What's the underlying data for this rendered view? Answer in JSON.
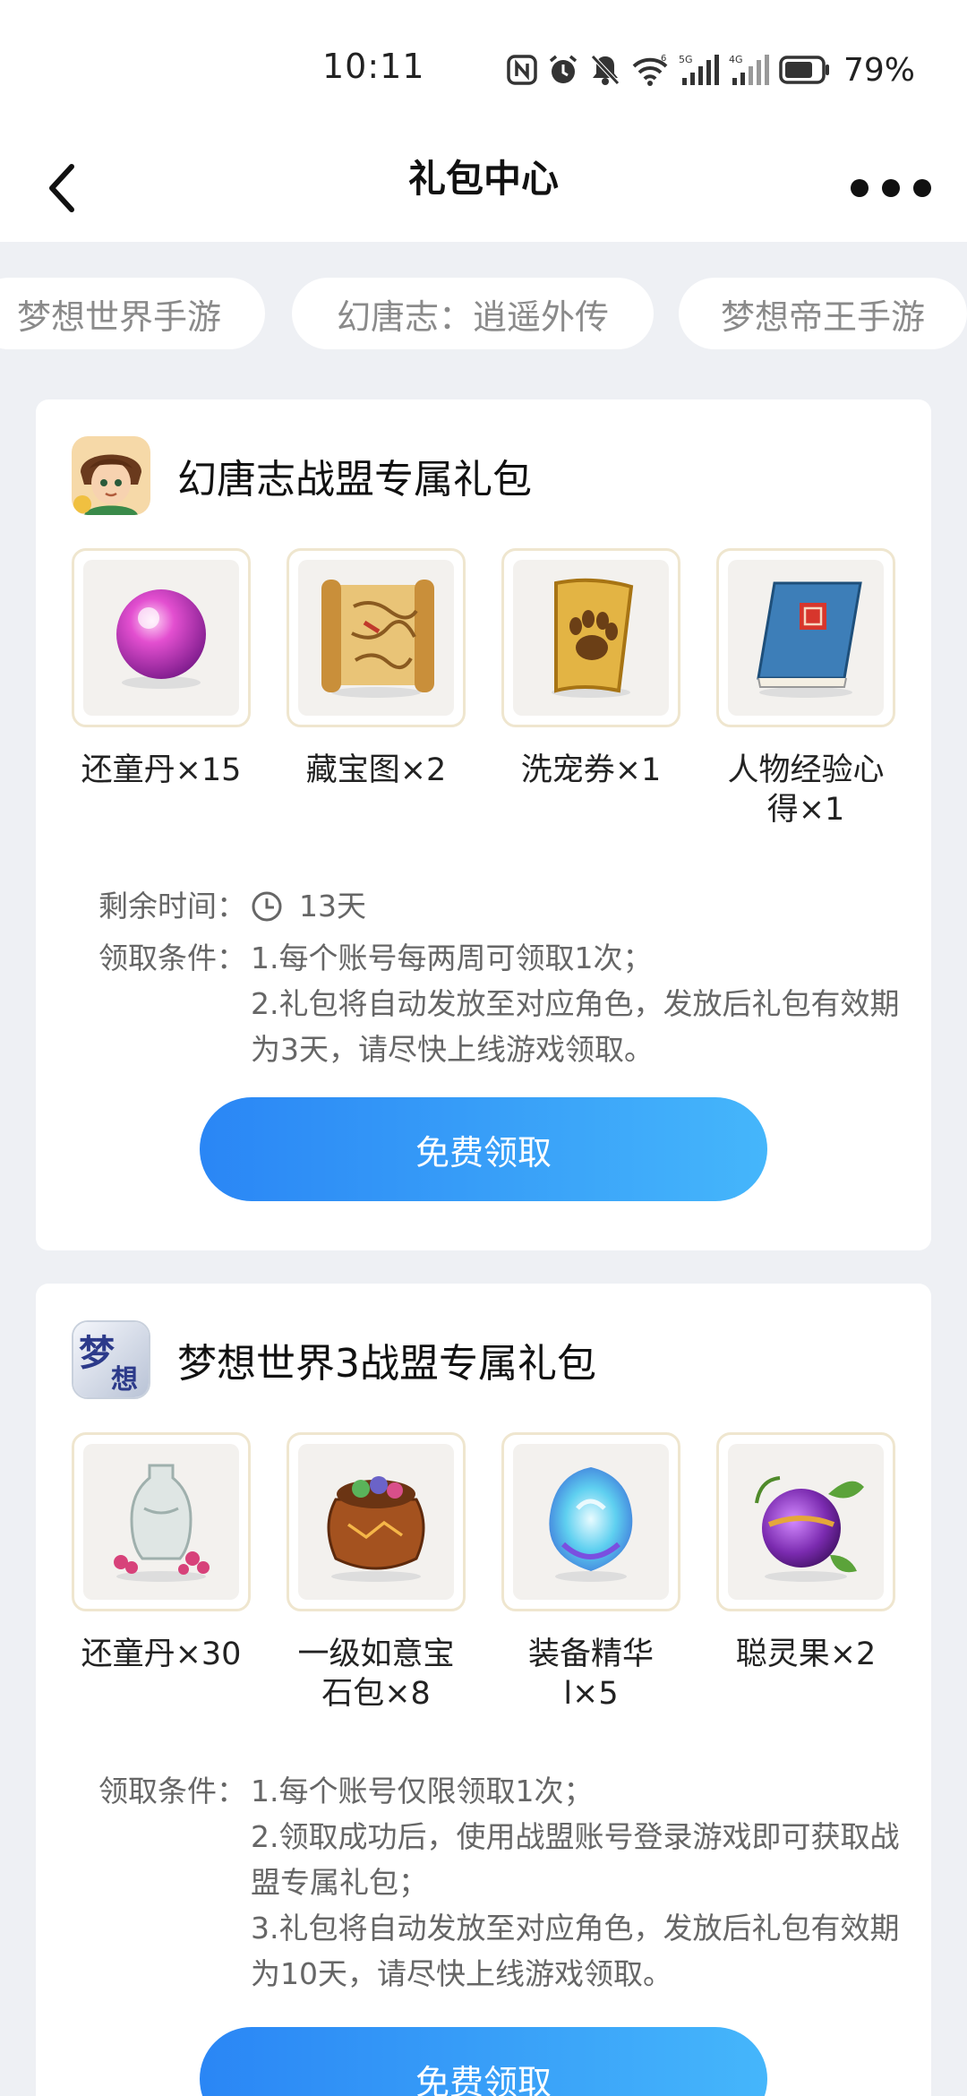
{
  "status_bar": {
    "time": "10:11",
    "battery": "79%"
  },
  "header": {
    "title": "礼包中心"
  },
  "tabs": [
    {
      "label": "梦想世界手游"
    },
    {
      "label": "幻唐志：逍遥外传"
    },
    {
      "label": "梦想帝王手游"
    }
  ],
  "gifts": [
    {
      "title": "幻唐志战盟专属礼包",
      "items": [
        {
          "label": "还童丹×15",
          "icon": "pink-orb-icon"
        },
        {
          "label": "藏宝图×2",
          "icon": "treasure-map-icon"
        },
        {
          "label": "洗宠券×1",
          "icon": "paw-scroll-icon"
        },
        {
          "label": "人物经验心\n得×1",
          "icon": "blue-book-icon"
        }
      ],
      "remaining_key": "剩余时间：",
      "remaining_value": "13天",
      "conditions_key": "领取条件：",
      "conditions": [
        "1.每个账号每两周可领取1次；",
        "2.礼包将自动发放至对应角色，发放后礼包有效期为3天，请尽快上线游戏领取。"
      ],
      "button": "免费领取"
    },
    {
      "title": "梦想世界3战盟专属礼包",
      "items": [
        {
          "label": "还童丹×30",
          "icon": "vase-icon"
        },
        {
          "label": "一级如意宝\n石包×8",
          "icon": "gem-bag-icon"
        },
        {
          "label": "装备精华\nl×5",
          "icon": "blue-essence-icon"
        },
        {
          "label": "聪灵果×2",
          "icon": "purple-fruit-icon"
        }
      ],
      "conditions_key": "领取条件：",
      "conditions": [
        "1.每个账号仅限领取1次；",
        "2.领取成功后，使用战盟账号登录游戏即可获取战盟专属礼包；",
        "3.礼包将自动发放至对应角色，发放后礼包有效期为10天，请尽快上线游戏领取。"
      ],
      "button": "免费领取"
    }
  ],
  "colors": {
    "accent_start": "#2a86f5",
    "accent_end": "#45b6fb",
    "background": "#eef0f4"
  }
}
